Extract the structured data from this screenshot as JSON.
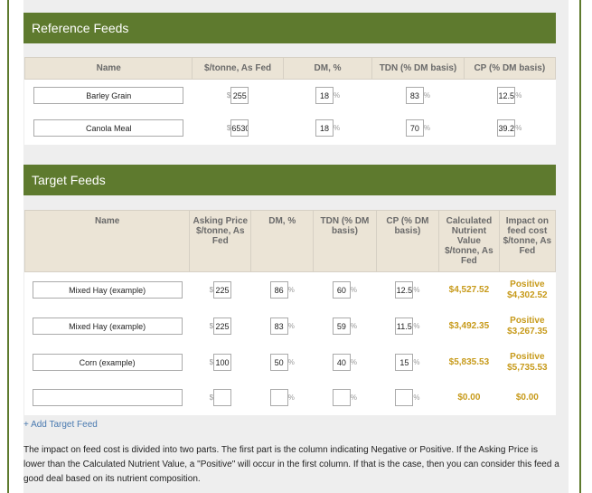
{
  "reference": {
    "title": "Reference Feeds",
    "headers": [
      "Name",
      "$/tonne, As Fed",
      "DM, %",
      "TDN (% DM basis)",
      "CP (% DM basis)"
    ],
    "rows": [
      {
        "name": "Barley Grain",
        "price": "255",
        "dm": "18",
        "tdn": "83",
        "cp": "12.5"
      },
      {
        "name": "Canola Meal",
        "price": "6530",
        "dm": "18",
        "tdn": "70",
        "cp": "39.2"
      }
    ]
  },
  "target": {
    "title": "Target Feeds",
    "headers": [
      "Name",
      "Asking Price $/tonne, As Fed",
      "DM, %",
      "TDN (% DM basis)",
      "CP (% DM basis)",
      "Calculated Nutrient Value $/tonne, As Fed",
      "Impact on feed cost $/tonne, As Fed"
    ],
    "rows": [
      {
        "name": "Mixed Hay (example)",
        "price": "225",
        "dm": "86",
        "tdn": "60",
        "cp": "12.5",
        "value": "$4,527.52",
        "impact_label": "Positive",
        "impact": "$4,302.52"
      },
      {
        "name": "Mixed Hay (example)",
        "price": "225",
        "dm": "83",
        "tdn": "59",
        "cp": "11.5",
        "value": "$3,492.35",
        "impact_label": "Positive",
        "impact": "$3,267.35"
      },
      {
        "name": "Corn (example)",
        "price": "100",
        "dm": "50",
        "tdn": "40",
        "cp": "15",
        "value": "$5,835.53",
        "impact_label": "Positive",
        "impact": "$5,735.53"
      },
      {
        "name": "",
        "price": "",
        "dm": "",
        "tdn": "",
        "cp": "",
        "value": "$0.00",
        "impact_label": "",
        "impact": "$0.00"
      }
    ]
  },
  "units": {
    "dollar": "$",
    "percent": "%"
  },
  "add_link": "+ Add Target Feed",
  "note": "The impact on feed cost is divided into two parts. The first part is the column indicating Negative or Positive. If the Asking Price is lower than the Calculated Nutrient Value, a \"Positive\" will occur in the first column. If that is the case, then you can consider this feed a good deal based on its nutrient composition.",
  "colors": {
    "header_green": "#5e7a2e",
    "money_gold": "#c79a1a",
    "table_header": "#ebe4d6",
    "link_blue": "#4a7ab0"
  }
}
